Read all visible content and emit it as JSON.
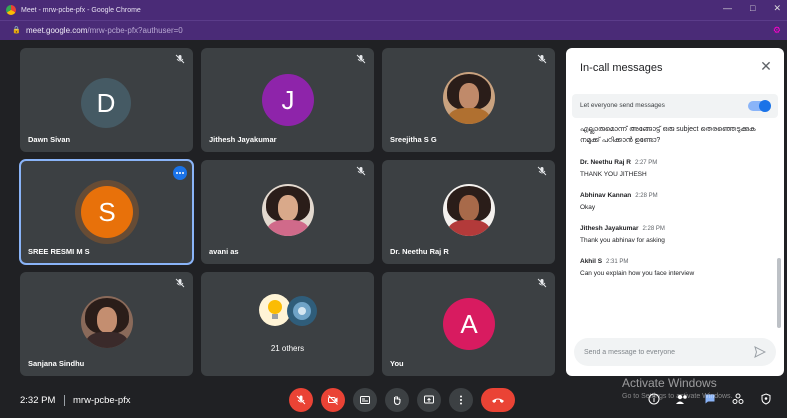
{
  "window": {
    "title": "Meet - mrw-pcbe-pfx - Google Chrome",
    "url_host": "meet.google.com",
    "url_path": "/mrw-pcbe-pfx?authuser=0"
  },
  "tiles": [
    {
      "name": "Dawn Sivan",
      "initial": "D",
      "color": "#455a64",
      "type": "initial"
    },
    {
      "name": "Jithesh Jayakumar",
      "initial": "J",
      "color": "#8e24aa",
      "type": "initial"
    },
    {
      "name": "Sreejitha S G",
      "type": "photo"
    },
    {
      "name": "SREE RESMI M S",
      "initial": "S",
      "color": "#e8710a",
      "type": "initial",
      "speaking": true
    },
    {
      "name": "avani as",
      "type": "photo"
    },
    {
      "name": "Dr. Neethu Raj R",
      "type": "photo"
    },
    {
      "name": "Sanjana Sindhu",
      "type": "photo"
    },
    {
      "name": "",
      "others": "21 others",
      "type": "others"
    },
    {
      "name": "You",
      "initial": "A",
      "color": "#d81b60",
      "type": "initial"
    }
  ],
  "chat": {
    "title": "In-call messages",
    "permission_label": "Let everyone send messages",
    "permission_on": true,
    "first_message": "എല്ലാരുമൊന്ന് അങ്ങോട്ട് ഒരു subject തെരഞ്ഞെടുക്കുക നമുക്ക് പഠിക്കാൻ ഉണ്ടോ?",
    "messages": [
      {
        "sender": "Dr. Neethu Raj R",
        "time": "2:27 PM",
        "text": "THANK YOU JITHESH"
      },
      {
        "sender": "Abhinav Kannan",
        "time": "2:28 PM",
        "text": "Okay"
      },
      {
        "sender": "Jithesh Jayakumar",
        "time": "2:28 PM",
        "text": "Thank you abhinav for asking"
      },
      {
        "sender": "Akhil S",
        "time": "2:31 PM",
        "text": "Can you explain how you face interview"
      }
    ],
    "input_placeholder": "Send a message to everyone"
  },
  "bottom": {
    "clock": "2:32 PM",
    "meeting_code": "mrw-pcbe-pfx"
  },
  "watermark": {
    "title": "Activate Windows",
    "subtitle": "Go to Settings to activate Windows."
  },
  "colors": {
    "accent": "#1a73e8",
    "danger": "#ea4335",
    "tile": "#3c4043",
    "background": "#202124"
  }
}
